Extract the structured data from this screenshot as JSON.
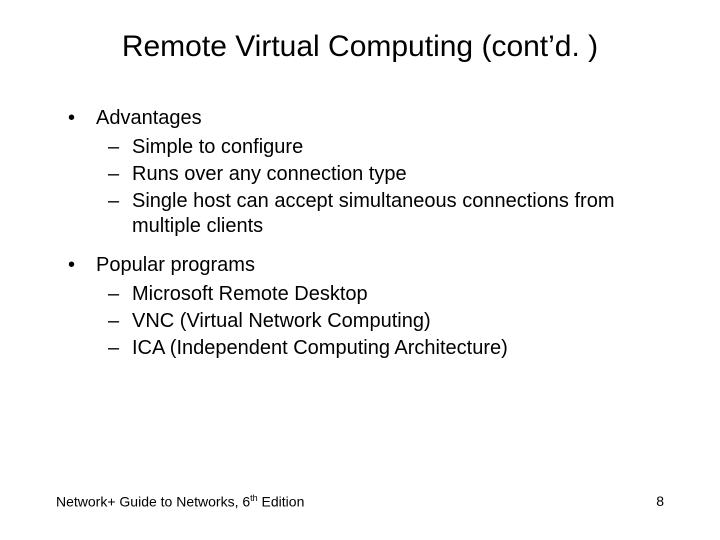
{
  "title": "Remote Virtual Computing (cont’d. )",
  "bullets": [
    {
      "label": "Advantages",
      "sub": [
        "Simple to configure",
        "Runs over any connection type",
        "Single host can accept simultaneous connections from multiple clients"
      ]
    },
    {
      "label": "Popular programs",
      "sub": [
        "Microsoft Remote Desktop",
        "VNC (Virtual Network Computing)",
        "ICA (Independent Computing Architecture)"
      ]
    }
  ],
  "footer_left_pre": "Network+ Guide to Networks, 6",
  "footer_left_sup": "th",
  "footer_left_post": " Edition",
  "page_number": "8"
}
